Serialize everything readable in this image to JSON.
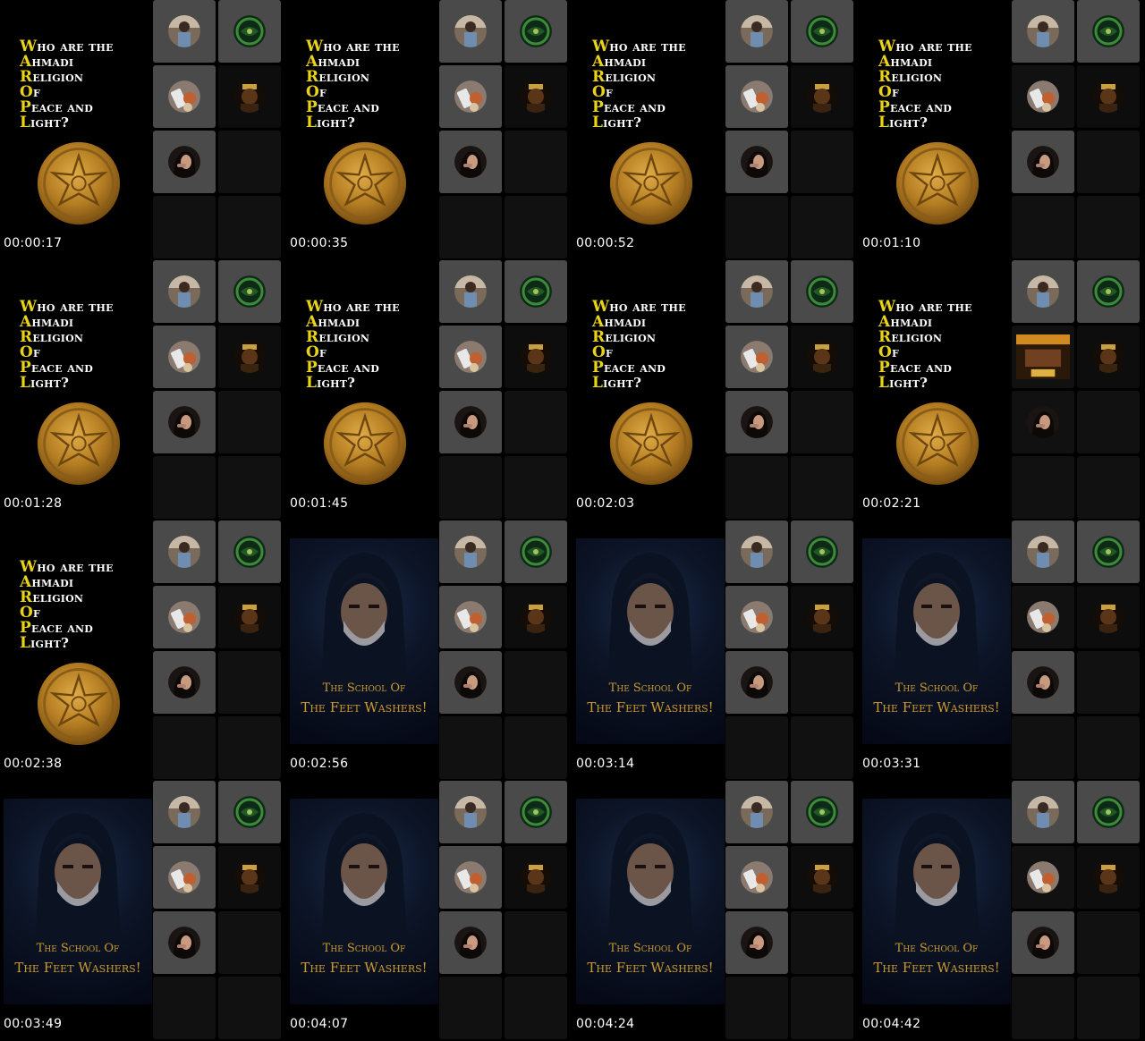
{
  "title_card": {
    "lines": [
      {
        "initial": "W",
        "rest": "ho are the"
      },
      {
        "initial": "A",
        "rest": "hmadi"
      },
      {
        "initial": "R",
        "rest": "eligion"
      },
      {
        "initial": "O",
        "rest": "f"
      },
      {
        "initial": "P",
        "rest": "eace and"
      },
      {
        "initial": "L",
        "rest": "ight?"
      }
    ]
  },
  "video_card": {
    "caption_line1": "The School Of",
    "caption_line2": "The Feet Washers!"
  },
  "colors": {
    "background": "#000000",
    "title_initial": "#e8d21a",
    "title_text": "#ffffff",
    "caption": "#c99a2e",
    "seal": "#c08a28"
  },
  "frames": [
    {
      "timestamp": "00:00:17",
      "content": "title",
      "variant": "a"
    },
    {
      "timestamp": "00:00:35",
      "content": "title",
      "variant": "a"
    },
    {
      "timestamp": "00:00:52",
      "content": "title",
      "variant": "b"
    },
    {
      "timestamp": "00:01:10",
      "content": "title",
      "variant": "c"
    },
    {
      "timestamp": "00:01:28",
      "content": "title",
      "variant": "a"
    },
    {
      "timestamp": "00:01:45",
      "content": "title",
      "variant": "a"
    },
    {
      "timestamp": "00:02:03",
      "content": "title",
      "variant": "a"
    },
    {
      "timestamp": "00:02:21",
      "content": "title",
      "variant": "d"
    },
    {
      "timestamp": "00:02:38",
      "content": "title",
      "variant": "a"
    },
    {
      "timestamp": "00:02:56",
      "content": "video",
      "variant": "a"
    },
    {
      "timestamp": "00:03:14",
      "content": "video",
      "variant": "a"
    },
    {
      "timestamp": "00:03:31",
      "content": "video",
      "variant": "c"
    },
    {
      "timestamp": "00:03:49",
      "content": "video",
      "variant": "a"
    },
    {
      "timestamp": "00:04:07",
      "content": "video",
      "variant": "a"
    },
    {
      "timestamp": "00:04:24",
      "content": "video",
      "variant": "b"
    },
    {
      "timestamp": "00:04:42",
      "content": "video",
      "variant": "c"
    }
  ],
  "participant_icons": [
    "person-avatar-icon",
    "green-emblem-icon",
    "phone-avatar-icon",
    "crowned-figure-icon",
    "woman-avatar-icon",
    "poster-thumbnail-icon"
  ]
}
